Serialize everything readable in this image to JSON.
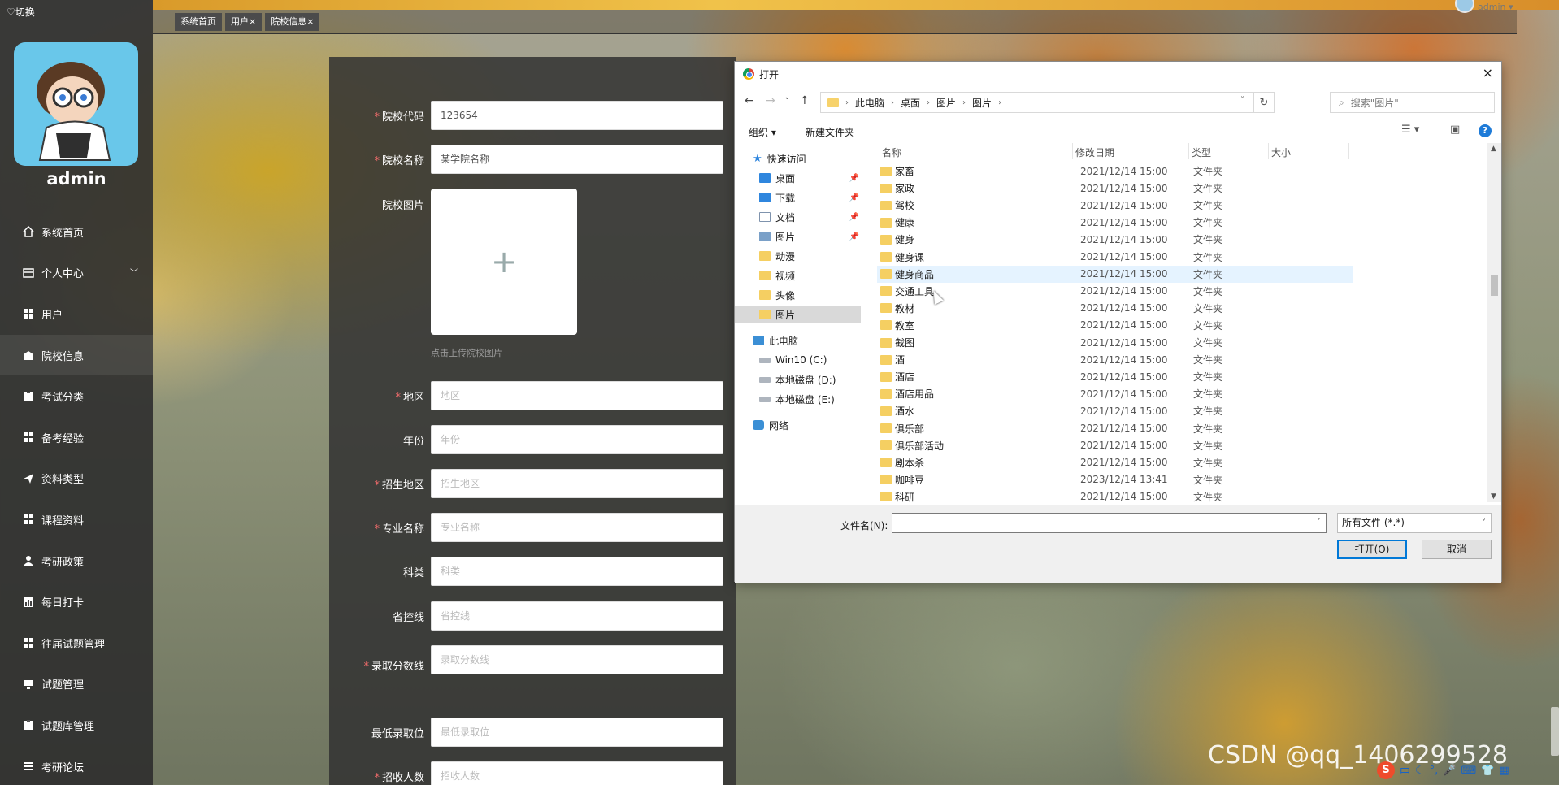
{
  "sidebar": {
    "switch_label": "♡切换",
    "username": "admin",
    "items": [
      {
        "label": "系统首页",
        "icon": "home-icon"
      },
      {
        "label": "个人中心",
        "icon": "user-card-icon"
      },
      {
        "label": "用户",
        "icon": "grid-icon"
      },
      {
        "label": "院校信息",
        "icon": "school-icon"
      },
      {
        "label": "考试分类",
        "icon": "clipboard-icon"
      },
      {
        "label": "备考经验",
        "icon": "grid-icon"
      },
      {
        "label": "资料类型",
        "icon": "send-icon"
      },
      {
        "label": "课程资料",
        "icon": "grid-icon"
      },
      {
        "label": "考研政策",
        "icon": "person-icon"
      },
      {
        "label": "每日打卡",
        "icon": "chart-icon"
      },
      {
        "label": "往届试题管理",
        "icon": "grid-icon"
      },
      {
        "label": "试题管理",
        "icon": "monitor-icon"
      },
      {
        "label": "试题库管理",
        "icon": "clipboard-icon"
      },
      {
        "label": "考研论坛",
        "icon": "list-icon"
      }
    ]
  },
  "tags": [
    "系统首页",
    "用户×",
    "院校信息×"
  ],
  "topbar": {
    "user": "admin ▾"
  },
  "form": {
    "fields": [
      {
        "label": "院校代码",
        "required": true,
        "value": "123654",
        "placeholder": ""
      },
      {
        "label": "院校名称",
        "required": true,
        "value": "某学院名称",
        "placeholder": ""
      },
      {
        "label": "院校图片",
        "required": false
      },
      {
        "label": "地区",
        "required": true,
        "value": "",
        "placeholder": "地区"
      },
      {
        "label": "年份",
        "required": false,
        "value": "",
        "placeholder": "年份"
      },
      {
        "label": "招生地区",
        "required": true,
        "value": "",
        "placeholder": "招生地区"
      },
      {
        "label": "专业名称",
        "required": true,
        "value": "",
        "placeholder": "专业名称"
      },
      {
        "label": "科类",
        "required": false,
        "value": "",
        "placeholder": "科类"
      },
      {
        "label": "省控线",
        "required": false,
        "value": "",
        "placeholder": "省控线"
      },
      {
        "label": "录取分数线",
        "required": true,
        "value": "",
        "placeholder": "录取分数线"
      },
      {
        "label": "最低录取位",
        "required": false,
        "value": "",
        "placeholder": "最低录取位"
      },
      {
        "label": "招收人数",
        "required": true,
        "value": "",
        "placeholder": "招收人数"
      }
    ],
    "upload_plus": "+",
    "upload_hint": "点击上传院校图片"
  },
  "dialog": {
    "title": "打开",
    "close": "×",
    "breadcrumb": [
      "此电脑",
      "桌面",
      "图片",
      "图片"
    ],
    "search_placeholder": "搜索\"图片\"",
    "organize": "组织 ▾",
    "new_folder": "新建文件夹",
    "nav": {
      "quick_access": "快速访问",
      "items": [
        {
          "label": "桌面",
          "pinned": true
        },
        {
          "label": "下载",
          "pinned": true
        },
        {
          "label": "文档",
          "pinned": true
        },
        {
          "label": "图片",
          "pinned": true
        },
        {
          "label": "动漫",
          "pinned": false
        },
        {
          "label": "视频",
          "pinned": false
        },
        {
          "label": "头像",
          "pinned": false
        },
        {
          "label": "图片",
          "pinned": false
        }
      ],
      "this_pc": "此电脑",
      "drives": [
        "Win10 (C:)",
        "本地磁盘 (D:)",
        "本地磁盘 (E:)"
      ],
      "network": "网络"
    },
    "columns": {
      "name": "名称",
      "date": "修改日期",
      "type": "类型",
      "size": "大小"
    },
    "files": [
      {
        "name": "家畜",
        "date": "2021/12/14 15:00",
        "type": "文件夹"
      },
      {
        "name": "家政",
        "date": "2021/12/14 15:00",
        "type": "文件夹"
      },
      {
        "name": "驾校",
        "date": "2021/12/14 15:00",
        "type": "文件夹"
      },
      {
        "name": "健康",
        "date": "2021/12/14 15:00",
        "type": "文件夹"
      },
      {
        "name": "健身",
        "date": "2021/12/14 15:00",
        "type": "文件夹"
      },
      {
        "name": "健身课",
        "date": "2021/12/14 15:00",
        "type": "文件夹"
      },
      {
        "name": "健身商品",
        "date": "2021/12/14 15:00",
        "type": "文件夹"
      },
      {
        "name": "交通工具",
        "date": "2021/12/14 15:00",
        "type": "文件夹"
      },
      {
        "name": "教材",
        "date": "2021/12/14 15:00",
        "type": "文件夹"
      },
      {
        "name": "教室",
        "date": "2021/12/14 15:00",
        "type": "文件夹"
      },
      {
        "name": "截图",
        "date": "2021/12/14 15:00",
        "type": "文件夹"
      },
      {
        "name": "酒",
        "date": "2021/12/14 15:00",
        "type": "文件夹"
      },
      {
        "name": "酒店",
        "date": "2021/12/14 15:00",
        "type": "文件夹"
      },
      {
        "name": "酒店用品",
        "date": "2021/12/14 15:00",
        "type": "文件夹"
      },
      {
        "name": "酒水",
        "date": "2021/12/14 15:00",
        "type": "文件夹"
      },
      {
        "name": "俱乐部",
        "date": "2021/12/14 15:00",
        "type": "文件夹"
      },
      {
        "name": "俱乐部活动",
        "date": "2021/12/14 15:00",
        "type": "文件夹"
      },
      {
        "name": "剧本杀",
        "date": "2021/12/14 15:00",
        "type": "文件夹"
      },
      {
        "name": "咖啡豆",
        "date": "2023/12/14 13:41",
        "type": "文件夹"
      },
      {
        "name": "科研",
        "date": "2021/12/14 15:00",
        "type": "文件夹"
      }
    ],
    "filename_label": "文件名(N):",
    "filename_value": "",
    "filetype": "所有文件 (*.*)",
    "open_button": "打开(O)",
    "cancel_button": "取消"
  },
  "watermark": "CSDN @qq_1406299528",
  "tray": {
    "ime": "中"
  }
}
